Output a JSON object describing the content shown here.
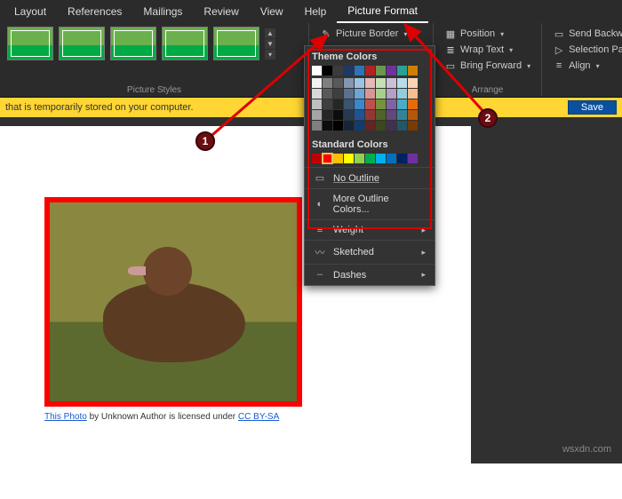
{
  "tabs": [
    "Layout",
    "References",
    "Mailings",
    "Review",
    "View",
    "Help",
    "Picture Format"
  ],
  "active_tab": "Picture Format",
  "ribbon": {
    "styles_label": "Picture Styles",
    "picture_border_label": "Picture Border",
    "arrange_label": "Arrange",
    "position": "Position",
    "wrap": "Wrap Text",
    "bring_forward": "Bring Forward",
    "send_backward": "Send Backward",
    "selection_pane": "Selection Pane",
    "align": "Align"
  },
  "panel": {
    "theme_hdr": "Theme Colors",
    "std_hdr": "Standard Colors",
    "theme_row": [
      "#ffffff",
      "#000000",
      "#3b3b3b",
      "#1f3864",
      "#2e74b5",
      "#b22222",
      "#6a994e",
      "#7030a0",
      "#2aa198",
      "#d17d00"
    ],
    "theme_shades": [
      [
        "#f2f2f2",
        "#7f7f7f",
        "#595959",
        "#8496b0",
        "#9cc3e5",
        "#e6b8b7",
        "#c5e0b3",
        "#ccc0d9",
        "#b6dde8",
        "#fbd4b4"
      ],
      [
        "#d8d8d8",
        "#595959",
        "#3f3f3f",
        "#5b718f",
        "#6aa6d8",
        "#da9694",
        "#a8d08d",
        "#b1a0c7",
        "#92cddc",
        "#f9bd8f"
      ],
      [
        "#bfbfbf",
        "#3f3f3f",
        "#262626",
        "#3b546f",
        "#3a88c8",
        "#c0504d",
        "#76923c",
        "#8064a2",
        "#4bacc6",
        "#e46c0a"
      ],
      [
        "#a5a5a5",
        "#262626",
        "#0c0c0c",
        "#27394f",
        "#1f5597",
        "#963634",
        "#4f6228",
        "#5f497a",
        "#31859b",
        "#b65708"
      ],
      [
        "#7f7f7f",
        "#0c0c0c",
        "#000000",
        "#172538",
        "#0f3d70",
        "#632423",
        "#3a481c",
        "#3f3151",
        "#205867",
        "#7b3a04"
      ]
    ],
    "std": [
      "#c00000",
      "#ff0000",
      "#ffc000",
      "#ffff00",
      "#92d050",
      "#00b050",
      "#00b0f0",
      "#0070c0",
      "#002060",
      "#7030a0"
    ],
    "selected_std_index": 1,
    "no_outline": "No Outline",
    "more_colors": "More Outline Colors...",
    "weight": "Weight",
    "sketched": "Sketched",
    "dashes": "Dashes"
  },
  "infobar": {
    "msg": "that is temporarily stored on your computer.",
    "save": "Save"
  },
  "caption": {
    "p1": "This Photo",
    "mid": " by Unknown Author is licensed under ",
    "p2": "CC BY-SA"
  },
  "callouts": {
    "one": "1",
    "two": "2"
  },
  "watermark": "wsxdn.com"
}
